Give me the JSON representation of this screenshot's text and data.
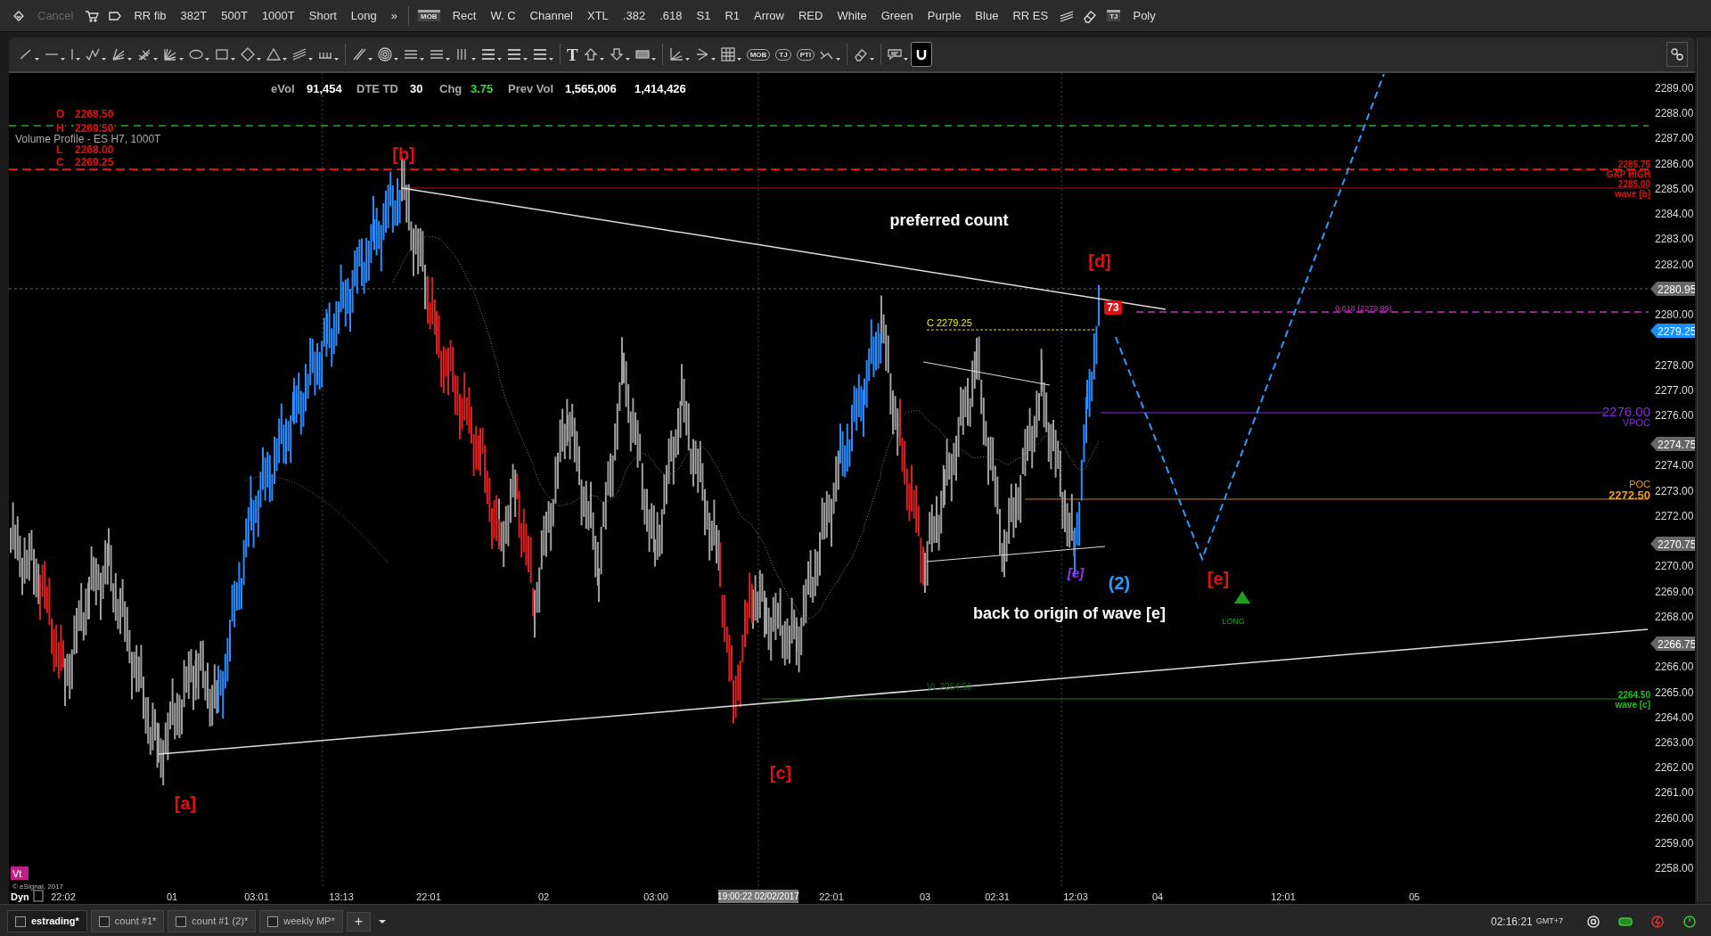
{
  "toolbar": {
    "items": [
      {
        "kind": "link"
      },
      {
        "kind": "text",
        "label": "Cancel",
        "disabled": true
      },
      {
        "kind": "cart"
      },
      {
        "kind": "tag"
      },
      {
        "kind": "text",
        "label": "RR fib",
        "disabled": false
      },
      {
        "kind": "text",
        "label": "382T",
        "disabled": false
      },
      {
        "kind": "text",
        "label": "500T",
        "disabled": false
      },
      {
        "kind": "text",
        "label": "1000T",
        "disabled": false
      },
      {
        "kind": "text",
        "label": "Short",
        "disabled": false
      },
      {
        "kind": "text",
        "label": "Long",
        "disabled": false
      },
      {
        "kind": "text",
        "label": "»",
        "disabled": false
      },
      {
        "kind": "separator"
      },
      {
        "kind": "badge",
        "label": "MOB"
      },
      {
        "kind": "text",
        "label": "Rect",
        "disabled": false
      },
      {
        "kind": "text",
        "label": "W. C",
        "disabled": false
      },
      {
        "kind": "text",
        "label": "Channel",
        "disabled": false
      },
      {
        "kind": "text",
        "label": "XTL",
        "disabled": false
      },
      {
        "kind": "text",
        "label": ".382",
        "disabled": false
      },
      {
        "kind": "text",
        "label": ".618",
        "disabled": false
      },
      {
        "kind": "text",
        "label": "S1",
        "disabled": false
      },
      {
        "kind": "text",
        "label": "R1",
        "disabled": false
      },
      {
        "kind": "text",
        "label": "Arrow",
        "disabled": false
      },
      {
        "kind": "text",
        "label": "RED",
        "disabled": false
      },
      {
        "kind": "text",
        "label": "White",
        "disabled": false
      },
      {
        "kind": "text",
        "label": "Green",
        "disabled": false
      },
      {
        "kind": "text",
        "label": "Purple",
        "disabled": false
      },
      {
        "kind": "text",
        "label": "Blue",
        "disabled": false
      },
      {
        "kind": "text",
        "label": "RR ES",
        "disabled": false
      },
      {
        "kind": "hatch"
      },
      {
        "kind": "eraser"
      },
      {
        "kind": "badge",
        "label": "TJ"
      },
      {
        "kind": "text",
        "label": "Poly",
        "disabled": false
      }
    ]
  },
  "drawing_tools": [
    {
      "kind": "line",
      "selected": false
    },
    {
      "kind": "hline",
      "selected": false
    },
    {
      "kind": "vline",
      "selected": false
    },
    {
      "kind": "zigzag",
      "selected": false
    },
    {
      "kind": "fan",
      "selected": false
    },
    {
      "kind": "pitchfork",
      "selected": false
    },
    {
      "kind": "gann",
      "selected": false
    },
    {
      "kind": "ellipse",
      "selected": false
    },
    {
      "kind": "rect",
      "selected": false
    },
    {
      "kind": "diamond",
      "selected": false
    },
    {
      "kind": "triangle",
      "selected": false
    },
    {
      "kind": "channel",
      "selected": false
    },
    {
      "kind": "cycles",
      "selected": false
    },
    {
      "kind": "separator"
    },
    {
      "kind": "parallel",
      "selected": false
    },
    {
      "kind": "target",
      "selected": false
    },
    {
      "kind": "lines",
      "selected": false
    },
    {
      "kind": "lines",
      "selected": false
    },
    {
      "kind": "vlines",
      "selected": false
    },
    {
      "kind": "bars",
      "selected": false
    },
    {
      "kind": "bars",
      "selected": false
    },
    {
      "kind": "bars",
      "selected": false
    },
    {
      "kind": "separator"
    },
    {
      "kind": "text",
      "label": "T",
      "selected": false
    },
    {
      "kind": "arrowup",
      "selected": false
    },
    {
      "kind": "arrowdown",
      "selected": false
    },
    {
      "kind": "box",
      "selected": false
    },
    {
      "kind": "separator"
    },
    {
      "kind": "axes",
      "selected": false
    },
    {
      "kind": "fanleft",
      "selected": false
    },
    {
      "kind": "grid",
      "selected": false
    },
    {
      "kind": "badge",
      "label": "MOB",
      "selected": false
    },
    {
      "kind": "badge",
      "label": "TJ",
      "selected": false
    },
    {
      "kind": "badge",
      "label": "PTI",
      "selected": false
    },
    {
      "kind": "trend",
      "selected": false
    },
    {
      "kind": "separator"
    },
    {
      "kind": "eraser",
      "selected": false
    },
    {
      "kind": "separator"
    },
    {
      "kind": "comment",
      "selected": false
    },
    {
      "kind": "magnet",
      "selected": true
    }
  ],
  "chart": {
    "info": [
      {
        "text": "eVol",
        "kind": "label"
      },
      {
        "text": "91,454",
        "kind": "value"
      },
      {
        "text": "DTE TD",
        "kind": "label"
      },
      {
        "text": "30",
        "kind": "value"
      },
      {
        "text": "Chg",
        "kind": "label"
      },
      {
        "text": "3.75",
        "kind": "up"
      },
      {
        "text": "Prev Vol",
        "kind": "label"
      },
      {
        "text": "1,565,006",
        "kind": "value"
      },
      {
        "text": "1,414,426",
        "kind": "value"
      }
    ],
    "ohlc": [
      {
        "label": "O",
        "value": "2268.50"
      },
      {
        "label": "H",
        "value": "2269.50"
      },
      {
        "label": "L",
        "value": "2268.00"
      },
      {
        "label": "C",
        "value": "2269.25"
      }
    ],
    "study_title": "Volume Profile - ES H7, 1000T",
    "y_ticks": [
      "2289.00",
      "2288.00",
      "2287.00",
      "2286.00",
      "2285.00",
      "2284.00",
      "2283.00",
      "2282.00",
      "2280.00",
      "2278.00",
      "2277.00",
      "2276.00",
      "2274.00",
      "2273.00",
      "2272.00",
      "2270.00",
      "2269.00",
      "2268.00",
      "2266.00",
      "2265.00",
      "2264.00",
      "2263.00",
      "2262.00",
      "2261.00",
      "2260.00",
      "2259.00",
      "2258.00"
    ],
    "price_tags": [
      {
        "text": "2280.95",
        "kind": "marker"
      },
      {
        "text": "2279.25",
        "kind": "last"
      },
      {
        "text": "2274.75",
        "kind": "marker"
      },
      {
        "text": "2270.75",
        "kind": "marker"
      },
      {
        "text": "2266.75",
        "kind": "marker"
      }
    ],
    "level_labels": [
      {
        "text": "2285.75",
        "color": "#e01010"
      },
      {
        "text": "GAP HIGH",
        "color": "#e01010"
      },
      {
        "text": "2285.00",
        "color": "#e01010"
      },
      {
        "text": "wave [b]",
        "color": "#e01010"
      },
      {
        "text": "2276.00",
        "color": "#8a2be2"
      },
      {
        "text": "VPOC",
        "color": "#8a2be2"
      },
      {
        "text": "POC",
        "color": "#f0a020"
      },
      {
        "text": "2272.50",
        "color": "#f0a020"
      },
      {
        "text": "2264.50",
        "color": "#20c020"
      },
      {
        "text": "wave [c]",
        "color": "#20c020"
      }
    ],
    "labels": [
      {
        "text": "[b]",
        "kind": "wave-red"
      },
      {
        "text": "[a]",
        "kind": "wave-red"
      },
      {
        "text": "[c]",
        "kind": "wave-red"
      },
      {
        "text": "[d]",
        "kind": "wave-red"
      },
      {
        "text": "[e]",
        "kind": "wave-purple"
      },
      {
        "text": "(2)",
        "kind": "wave-blue"
      },
      {
        "text": "[e]",
        "kind": "wave-red"
      },
      {
        "text": "preferred count",
        "kind": "note"
      },
      {
        "text": "back to origin of wave [e]",
        "kind": "note"
      },
      {
        "text": "LONG",
        "kind": "long"
      },
      {
        "text": "73",
        "kind": "boxed"
      },
      {
        "text": "C 2279.25",
        "kind": "yellow"
      },
      {
        "text": "VL 2264.50",
        "kind": "dim"
      },
      {
        "text": "0.618 (2279.99)",
        "kind": "magenta"
      }
    ],
    "x_labels": [
      "22:02",
      "01",
      "03:01",
      "13:13",
      "22:01",
      "02",
      "03:00",
      "22:01",
      "03",
      "02:31",
      "12:03",
      "04",
      "12:01",
      "05"
    ],
    "time_cursor": "19:00:22 02/02/2017",
    "badge": "Vt",
    "copyright": "© eSignal, 2017",
    "mode": "Dyn"
  },
  "tabs": [
    {
      "label": "estrading*",
      "selected": true,
      "checked": false
    },
    {
      "label": "count #1*",
      "selected": false,
      "checked": false
    },
    {
      "label": "count #1 (2)*",
      "selected": false,
      "checked": false
    },
    {
      "label": "weekly MP*",
      "selected": false,
      "checked": false
    }
  ],
  "add_tab": "+",
  "status_bar": {
    "time": "02:16:21",
    "zone": "GMT+7"
  }
}
